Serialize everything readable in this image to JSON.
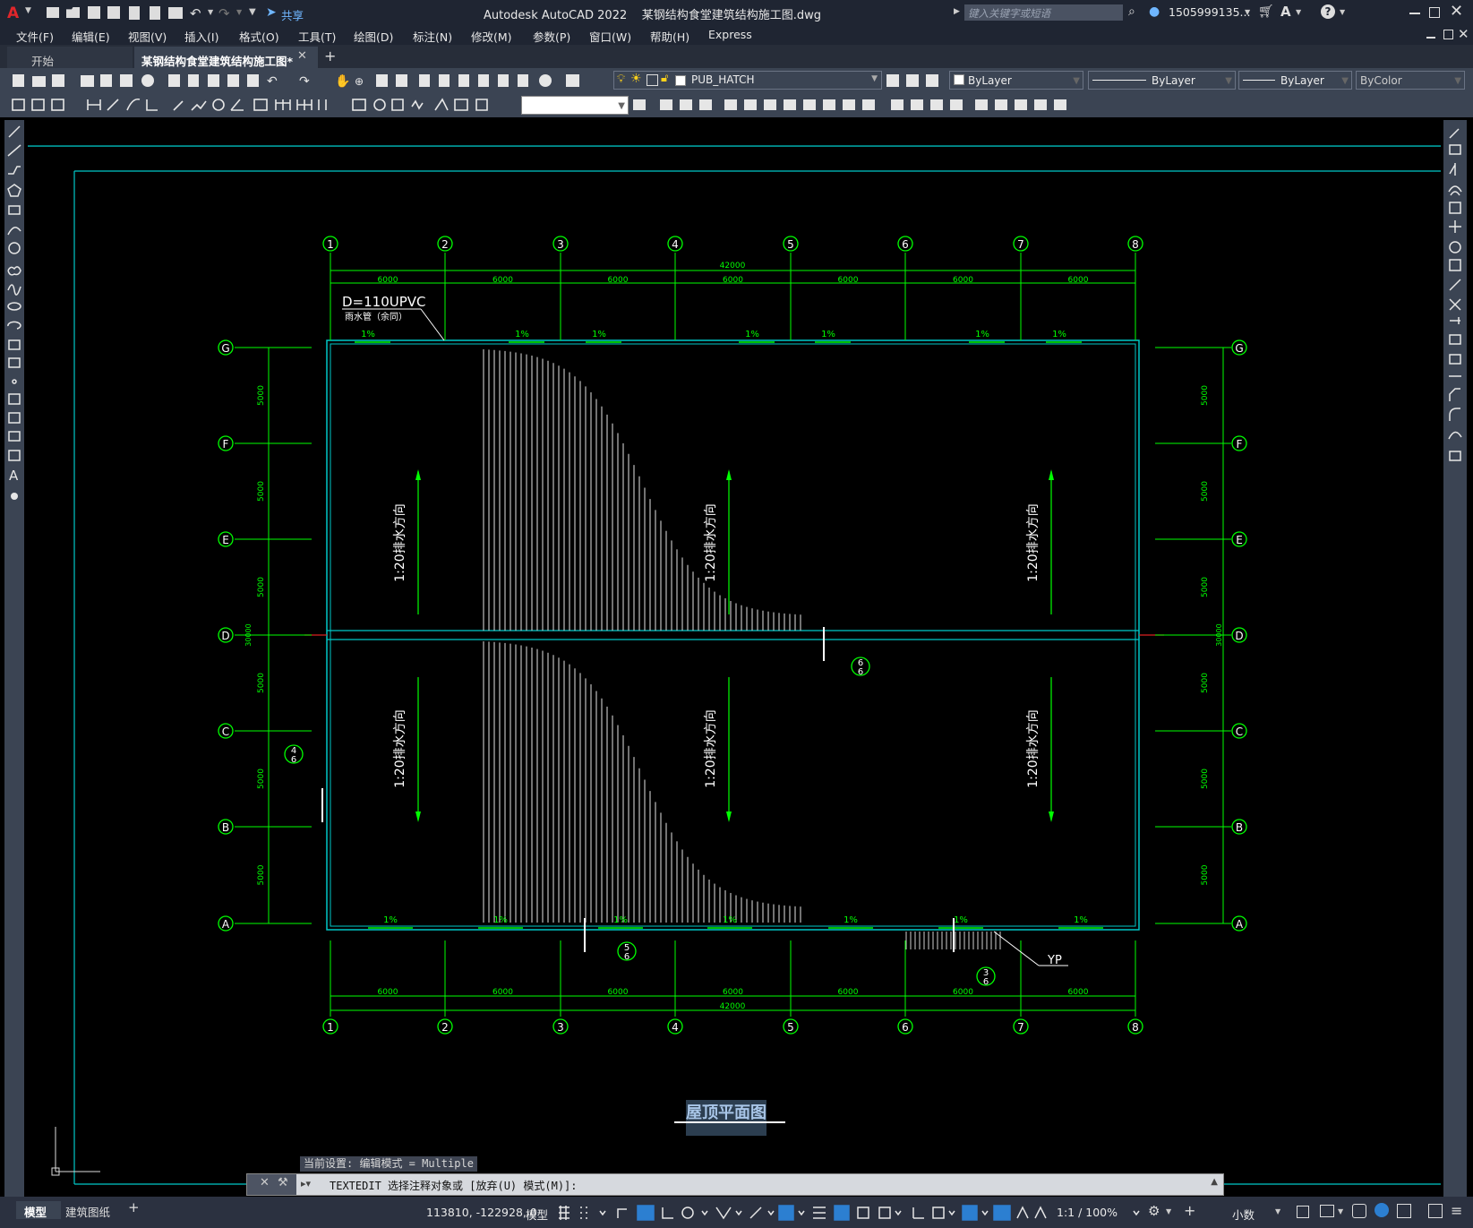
{
  "app": {
    "title": "Autodesk AutoCAD 2022    某钢结构食堂建筑结构施工图.dwg",
    "search_placeholder": "键入关键字或短语",
    "user": "1505999135...",
    "share_label": "共享"
  },
  "menus": [
    "文件(F)",
    "编辑(E)",
    "视图(V)",
    "插入(I)",
    "格式(O)",
    "工具(T)",
    "绘图(D)",
    "标注(N)",
    "修改(M)",
    "参数(P)",
    "窗口(W)",
    "帮助(H)",
    "Express"
  ],
  "tabs": {
    "start": "开始",
    "active": "某钢结构食堂建筑结构施工图*",
    "add": "+"
  },
  "toolbar": {
    "layer": "PUB_HATCH",
    "color": "ByLayer",
    "linetype": "ByLayer",
    "lineweight": "ByLayer",
    "plotstyle": "ByColor"
  },
  "drawing": {
    "title": "屋顶平面图",
    "grid_cols": [
      "1",
      "2",
      "3",
      "4",
      "5",
      "6",
      "7",
      "8"
    ],
    "grid_rows": [
      "G",
      "F",
      "E",
      "D",
      "C",
      "B",
      "A"
    ],
    "span_label": "6000",
    "total_label": "42000",
    "bay_label": "5000",
    "total_height_label": "30000",
    "pipe_label": "D=110UPVC",
    "pipe_sub": "雨水管（余同）",
    "slope_label": "1%",
    "drain_label": "1:20排水方向",
    "yp_label": "YP",
    "callouts": [
      {
        "top": "6",
        "bottom": "6"
      },
      {
        "top": "4",
        "bottom": "6"
      },
      {
        "top": "5",
        "bottom": "6"
      },
      {
        "top": "3",
        "bottom": "6"
      }
    ]
  },
  "command": {
    "history": "当前设置: 编辑模式 = Multiple",
    "prompt": "TEXTEDIT 选择注释对象或 [放弃(U) 模式(M)]:"
  },
  "status": {
    "coords": "113810, -122928, 0",
    "model": "模型",
    "scale": "1:1 / 100%",
    "units": "小数",
    "tab_model": "模型",
    "tab_layout": "建筑图纸"
  },
  "colors": {
    "grid": "#00ff00",
    "outline": "#00c8c8",
    "background": "#000000",
    "chrome": "#3b4453"
  }
}
